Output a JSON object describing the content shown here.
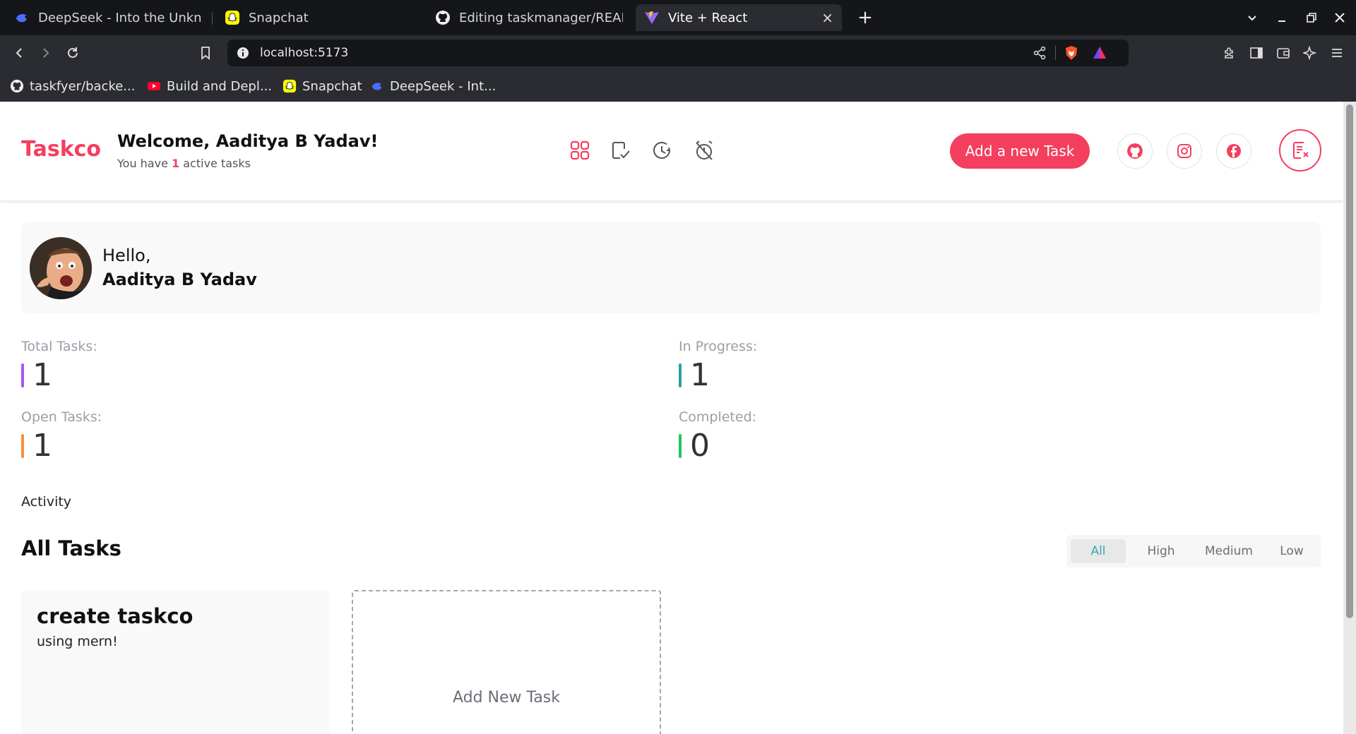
{
  "browser": {
    "tabs": [
      {
        "title": "DeepSeek - Into the Unknow",
        "icon": "deepseek-icon"
      },
      {
        "title": "Snapchat",
        "icon": "snapchat-icon"
      },
      {
        "title": "Editing taskmanager/READM",
        "icon": "github-icon"
      },
      {
        "title": "Vite + React",
        "icon": "vite-icon",
        "active": true
      }
    ],
    "new_tab": "+",
    "close_tab": "×",
    "url": "localhost:5173",
    "bookmarks": [
      {
        "title": "taskfyer/backe...",
        "icon": "github-icon"
      },
      {
        "title": "Build and Depl...",
        "icon": "youtube-icon"
      },
      {
        "title": "Snapchat",
        "icon": "snapchat-icon"
      },
      {
        "title": "DeepSeek - Int...",
        "icon": "deepseek-icon"
      }
    ]
  },
  "app": {
    "logo": "Taskco",
    "welcome": "Welcome, Aaditya B Yadav!",
    "subtext_pre": "You have ",
    "active_count": "1",
    "subtext_post": " active tasks",
    "add_task_button": "Add a new Task",
    "nav_icons": [
      "grid-icon",
      "completed-tasks-icon",
      "pending-clock-icon",
      "overdue-alarm-icon"
    ],
    "social_icons": [
      "github-icon",
      "instagram-icon",
      "facebook-icon"
    ],
    "profile_icon": "task-report-icon",
    "accent": "#f43f5e"
  },
  "profile": {
    "greeting": "Hello,",
    "name": "Aaditya B Yadav"
  },
  "stats": [
    {
      "label": "Total Tasks:",
      "value": "1",
      "color": "#a855f7"
    },
    {
      "label": "In Progress:",
      "value": "1",
      "color": "#2aa3a0"
    },
    {
      "label": "Open Tasks:",
      "value": "1",
      "color": "#f4913d"
    },
    {
      "label": "Completed:",
      "value": "0",
      "color": "#22c55e"
    }
  ],
  "activity_label": "Activity",
  "tasks_section": {
    "title": "All Tasks",
    "filters": [
      "All",
      "High",
      "Medium",
      "Low"
    ],
    "selected_filter": "All",
    "tasks": [
      {
        "title": "create taskco",
        "description": "using mern!"
      }
    ],
    "add_card_label": "Add New Task"
  }
}
